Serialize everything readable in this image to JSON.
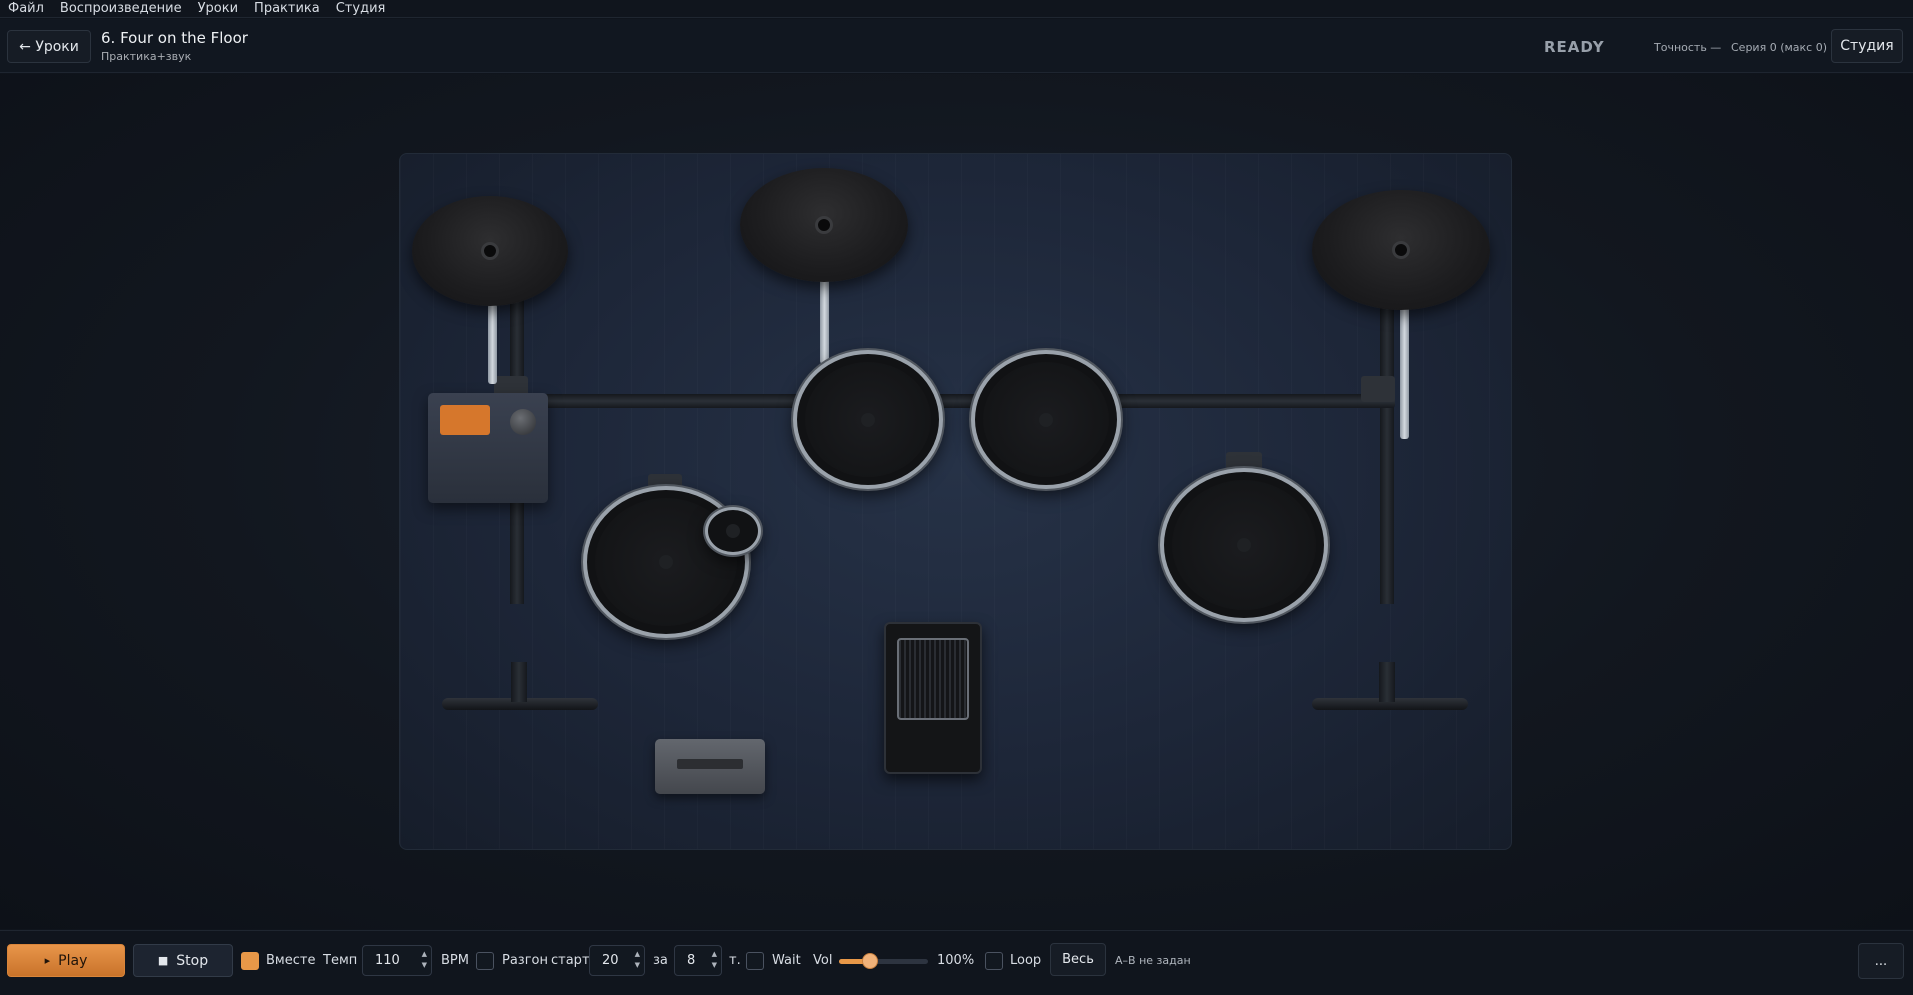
{
  "menu": [
    "Файл",
    "Воспроизведение",
    "Уроки",
    "Практика",
    "Студия"
  ],
  "header": {
    "back_label": "← Уроки",
    "title": "6. Four on the Floor",
    "subtitle": "Практика+звук",
    "status": "READY",
    "accuracy": "Точность —",
    "series": "Серия 0 (макс 0)",
    "studio_label": "Студия"
  },
  "kit": {
    "module_screen_color": "#d6772c",
    "pieces": [
      "crash-cymbal",
      "ride-cymbal",
      "hihat-cymbal",
      "tom-1",
      "tom-2",
      "snare",
      "floor-tom",
      "kick-pedal",
      "hihat-pedal",
      "drum-module"
    ]
  },
  "transport": {
    "play_label": "Play",
    "play_icon": "▸",
    "stop_label": "Stop",
    "stop_icon": "■",
    "together_label": "Вместе",
    "together_checked": true,
    "tempo_label": "Темп",
    "tempo_value": "110",
    "bpm_label": "BPM",
    "ramp_label": "Разгон",
    "ramp_checked": false,
    "start_label": "старт",
    "start_value": "20",
    "over_label": "за",
    "over_value": "8",
    "bars_label": "т.",
    "wait_label": "Wait",
    "wait_checked": false,
    "vol_label": "Vol",
    "vol_value": "100%",
    "vol_slider_fraction": 0.35,
    "loop_label": "Loop",
    "loop_checked": false,
    "range_label": "Весь",
    "ab_status": "А–В не задан",
    "more_label": "..."
  },
  "colors": {
    "accent": "#e89848",
    "background": "#0f141c"
  }
}
